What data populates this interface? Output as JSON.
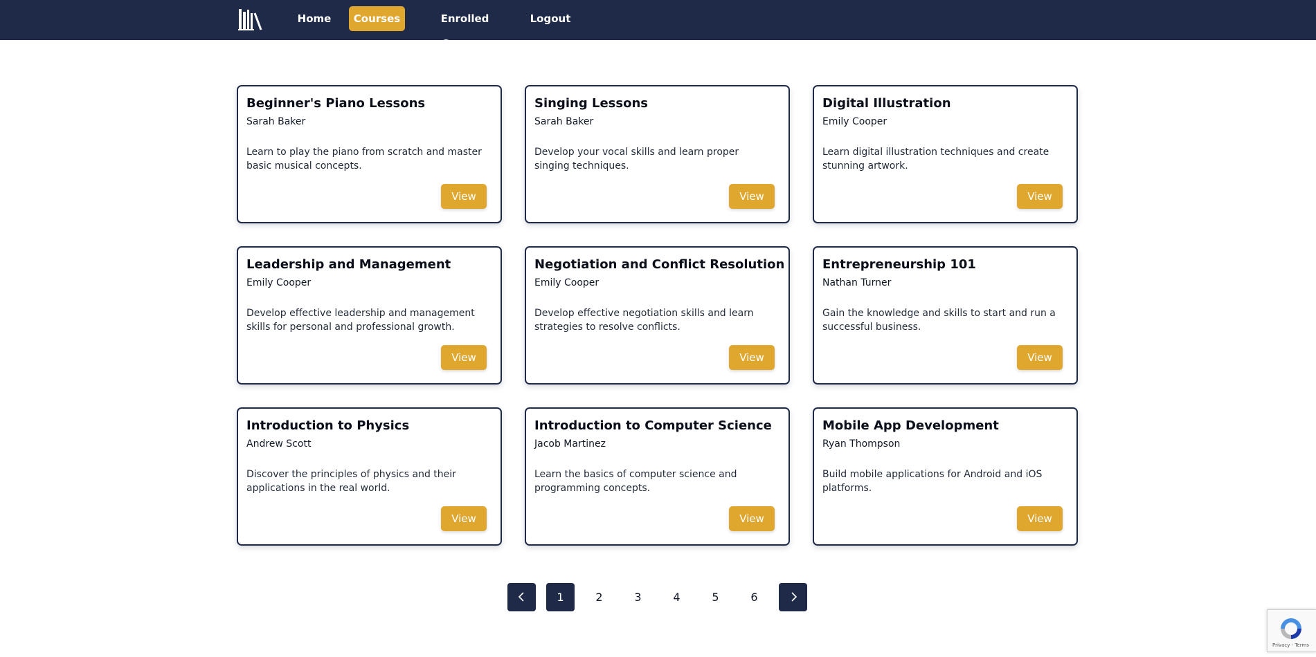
{
  "nav": {
    "items": [
      {
        "label": "Home"
      },
      {
        "label": "Courses",
        "active": true
      },
      {
        "label": "Enrolled Courses"
      },
      {
        "label": "Logout"
      }
    ]
  },
  "courses": [
    {
      "title": "Beginner's Piano Lessons",
      "instructor": "Sarah Baker",
      "description": "Learn to play the piano from scratch and master basic musical concepts.",
      "button": "View"
    },
    {
      "title": "Singing Lessons",
      "instructor": "Sarah Baker",
      "description": "Develop your vocal skills and learn proper singing techniques.",
      "button": "View"
    },
    {
      "title": "Digital Illustration",
      "instructor": "Emily Cooper",
      "description": "Learn digital illustration techniques and create stunning artwork.",
      "button": "View"
    },
    {
      "title": "Leadership and Management",
      "instructor": "Emily Cooper",
      "description": "Develop effective leadership and management skills for personal and professional growth.",
      "button": "View"
    },
    {
      "title": "Negotiation and Conflict Resolution",
      "instructor": "Emily Cooper",
      "description": "Develop effective negotiation skills and learn strategies to resolve conflicts.",
      "button": "View"
    },
    {
      "title": "Entrepreneurship 101",
      "instructor": "Nathan Turner",
      "description": "Gain the knowledge and skills to start and run a successful business.",
      "button": "View"
    },
    {
      "title": "Introduction to Physics",
      "instructor": "Andrew Scott",
      "description": "Discover the principles of physics and their applications in the real world.",
      "button": "View"
    },
    {
      "title": "Introduction to Computer Science",
      "instructor": "Jacob Martinez",
      "description": "Learn the basics of computer science and programming concepts.",
      "button": "View"
    },
    {
      "title": "Mobile App Development",
      "instructor": "Ryan Thompson",
      "description": "Build mobile applications for Android and iOS platforms.",
      "button": "View"
    }
  ],
  "pagination": {
    "pages": [
      "1",
      "2",
      "3",
      "4",
      "5",
      "6"
    ],
    "current": "1",
    "prev_icon": "chevron-left-icon",
    "next_icon": "chevron-right-icon"
  },
  "recaptcha": {
    "text": "Privacy - Terms"
  },
  "colors": {
    "navbar": "#1e2a47",
    "accent": "#e0a72e",
    "card_border": "#1e2a47",
    "page_active": "#1e2a47"
  }
}
